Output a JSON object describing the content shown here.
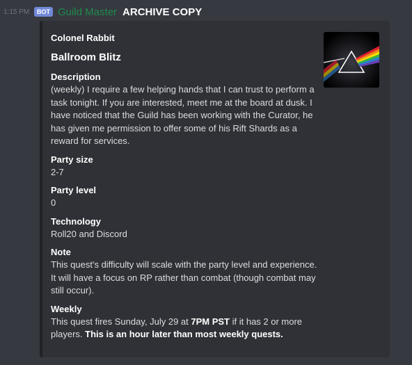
{
  "message": {
    "timestamp": "1:15 PM",
    "bot_tag": "BOT",
    "username": "Guild Master",
    "header_text": "ARCHIVE COPY",
    "username_color": "#1f8b4c"
  },
  "embed": {
    "author": "Colonel Rabbit",
    "title": "Ballroom Blitz",
    "thumbnail_icon": "prism-album-art",
    "fields": [
      {
        "name": "Description",
        "value": "(weekly) I require a few helping hands that I can trust to perform a task tonight. If you are interested, meet me at the board at dusk. I have noticed that the Guild has been working with the Curator, he has given me permission to offer some of his Rift Shards as a reward for services."
      },
      {
        "name": "Party size",
        "value": "2-7"
      },
      {
        "name": "Party level",
        "value": "0"
      },
      {
        "name": "Technology",
        "value": "Roll20 and Discord"
      },
      {
        "name": "Note",
        "value": "This quest's difficulty will scale with the party level and experience. It will have a focus on RP rather than combat (though combat may still occur)."
      },
      {
        "name": "Weekly",
        "value_parts": {
          "pre": "This quest fires Sunday, July 29 at ",
          "time": "7PM PST",
          "mid": " if it has 2 or more players. ",
          "emphasis": "This is an hour later than most weekly quests."
        }
      }
    ]
  }
}
